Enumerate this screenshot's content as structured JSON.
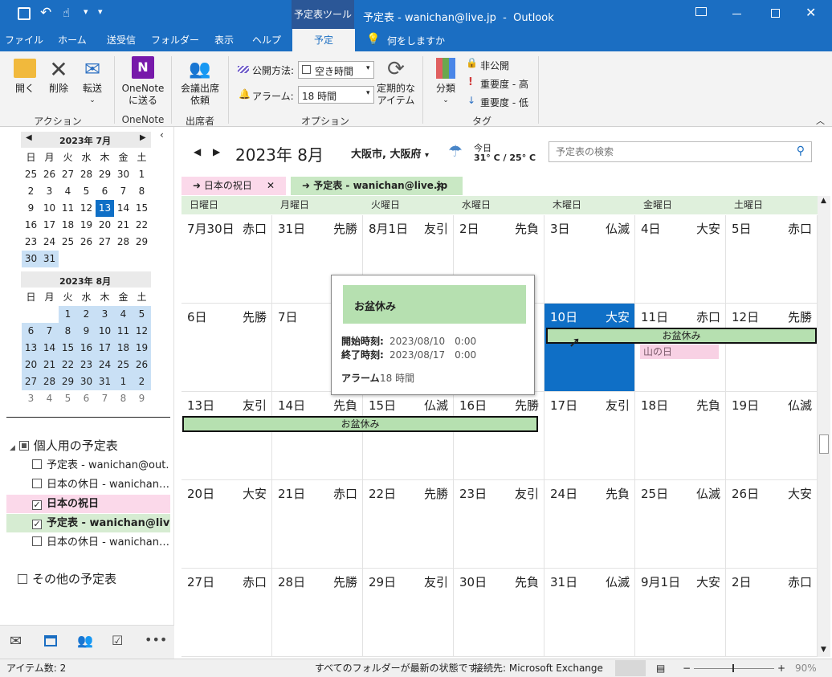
{
  "title": {
    "context_tab": "予定表ツール",
    "window_title": "予定表 - wanichan@live.jp  -  Outlook"
  },
  "tabs": [
    "ファイル",
    "ホーム",
    "送受信",
    "フォルダー",
    "表示",
    "ヘルプ",
    "予定"
  ],
  "tell_me": "何をしますか",
  "ribbon": {
    "open": "開く",
    "delete": "削除",
    "forward": "転送",
    "onenote": "OneNote",
    "onenote2": "に送る",
    "meeting_attendees1": "会議出席",
    "meeting_attendees2": "依頼",
    "recurrence1": "定期的な",
    "recurrence2": "アイテム",
    "categorize": "分類",
    "private": "非公開",
    "high": "重要度 - 高",
    "low": "重要度 - 低",
    "show_as_label": "公開方法:",
    "show_as_value": "空き時間",
    "reminder_label": "アラーム:",
    "reminder_value": "18 時間",
    "groups": {
      "actions": "アクション",
      "onenote": "OneNote",
      "attendees": "出席者",
      "options": "オプション",
      "tags": "タグ"
    }
  },
  "minical": {
    "july": {
      "title": "2023年 7月",
      "weekdays": [
        "日",
        "月",
        "火",
        "水",
        "木",
        "金",
        "土"
      ],
      "rows": [
        [
          "25",
          "26",
          "27",
          "28",
          "29",
          "30",
          "1"
        ],
        [
          "2",
          "3",
          "4",
          "5",
          "6",
          "7",
          "8"
        ],
        [
          "9",
          "10",
          "11",
          "12",
          "13",
          "14",
          "15"
        ],
        [
          "16",
          "17",
          "18",
          "19",
          "20",
          "21",
          "22"
        ],
        [
          "23",
          "24",
          "25",
          "26",
          "27",
          "28",
          "29"
        ],
        [
          "30",
          "31",
          "",
          "",
          "",
          "",
          ""
        ]
      ]
    },
    "august": {
      "title": "2023年 8月",
      "weekdays": [
        "日",
        "月",
        "火",
        "水",
        "木",
        "金",
        "土"
      ],
      "rows": [
        [
          "",
          "",
          "1",
          "2",
          "3",
          "4",
          "5"
        ],
        [
          "6",
          "7",
          "8",
          "9",
          "10",
          "11",
          "12"
        ],
        [
          "13",
          "14",
          "15",
          "16",
          "17",
          "18",
          "19"
        ],
        [
          "20",
          "21",
          "22",
          "23",
          "24",
          "25",
          "26"
        ],
        [
          "27",
          "28",
          "29",
          "30",
          "31",
          "1",
          "2"
        ],
        [
          "3",
          "4",
          "5",
          "6",
          "7",
          "8",
          "9"
        ]
      ]
    }
  },
  "folders": {
    "group_personal": "個人用の予定表",
    "items": [
      "予定表 - wanichan@out…",
      "日本の休日 - wanichan…",
      "日本の祝日",
      "予定表 - wanichan@live…",
      "日本の休日 - wanichan…"
    ],
    "group_other": "その他の予定表"
  },
  "header": {
    "month": "2023年 8月",
    "location": "大阪市, 大阪府",
    "weather_today": "今日",
    "weather_temp": "31° C / 25° C",
    "search_placeholder": "予定表の検索"
  },
  "cal_tabs": [
    "日本の祝日",
    "予定表 - wanichan@live.jp"
  ],
  "weekdays": [
    "日曜日",
    "月曜日",
    "火曜日",
    "水曜日",
    "木曜日",
    "金曜日",
    "土曜日"
  ],
  "weeks": [
    [
      [
        "7月30日",
        "赤口"
      ],
      [
        "31日",
        "先勝"
      ],
      [
        "8月1日",
        "友引"
      ],
      [
        "2日",
        "先負"
      ],
      [
        "3日",
        "仏滅"
      ],
      [
        "4日",
        "大安"
      ],
      [
        "5日",
        "赤口"
      ]
    ],
    [
      [
        "6日",
        "先勝"
      ],
      [
        "7日",
        ""
      ],
      [
        "",
        ""
      ],
      [
        "",
        ""
      ],
      [
        "10日",
        "大安"
      ],
      [
        "11日",
        "赤口"
      ],
      [
        "12日",
        "先勝"
      ]
    ],
    [
      [
        "13日",
        "友引"
      ],
      [
        "14日",
        "先負"
      ],
      [
        "15日",
        "仏滅"
      ],
      [
        "16日",
        "先勝"
      ],
      [
        "17日",
        "友引"
      ],
      [
        "18日",
        "先負"
      ],
      [
        "19日",
        "仏滅"
      ]
    ],
    [
      [
        "20日",
        "大安"
      ],
      [
        "21日",
        "赤口"
      ],
      [
        "22日",
        "先勝"
      ],
      [
        "23日",
        "友引"
      ],
      [
        "24日",
        "先負"
      ],
      [
        "25日",
        "仏滅"
      ],
      [
        "26日",
        "大安"
      ]
    ],
    [
      [
        "27日",
        "赤口"
      ],
      [
        "28日",
        "先勝"
      ],
      [
        "29日",
        "友引"
      ],
      [
        "30日",
        "先負"
      ],
      [
        "31日",
        "仏滅"
      ],
      [
        "9月1日",
        "大安"
      ],
      [
        "2日",
        "赤口"
      ]
    ]
  ],
  "events": {
    "obon": "お盆休み",
    "yamanohi": "山の日"
  },
  "popup": {
    "title": "お盆休み",
    "start_label": "開始時刻:",
    "start_value": "2023/08/10　0:00",
    "end_label": "終了時刻:",
    "end_value": "2023/08/17　0:00",
    "reminder_label": "アラーム",
    "reminder_value": "18 時間"
  },
  "status": {
    "items": "アイテム数: 2",
    "folders": "すべてのフォルダーが最新の状態です。",
    "connection": "接続先: Microsoft Exchange",
    "zoom": "90%"
  }
}
